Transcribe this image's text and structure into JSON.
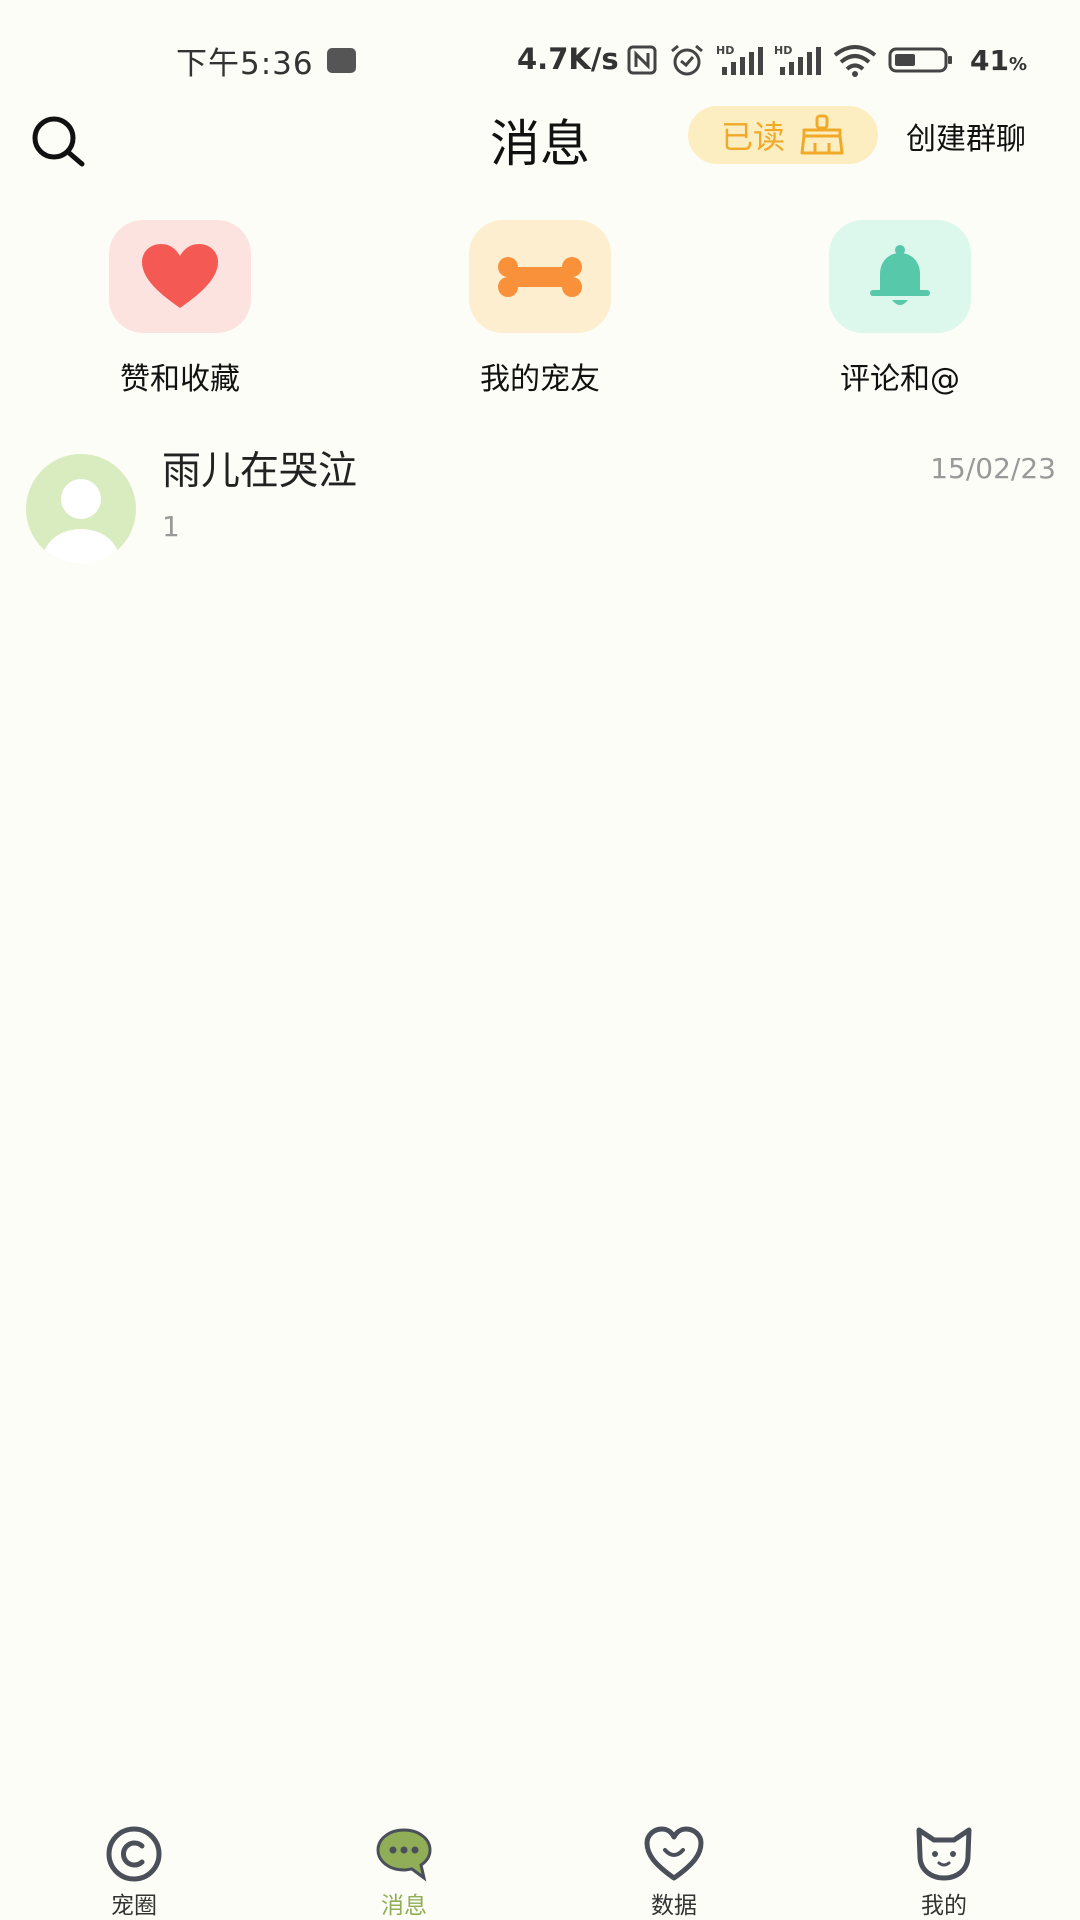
{
  "status_bar": {
    "time": "下午5:36",
    "network_speed": "4.7K/s",
    "battery_percent": "41",
    "battery_unit": "%",
    "icons": [
      "nfc-icon",
      "alarm-icon",
      "hd-signal-icon",
      "hd-signal-icon",
      "wifi-icon",
      "battery-icon"
    ]
  },
  "header": {
    "title": "消息",
    "read_label": "已读",
    "create_group_label": "创建群聊"
  },
  "quick_entries": [
    {
      "label": "赞和收藏",
      "icon": "heart-icon",
      "tile_color": "#fde3df",
      "icon_color": "#f45a53"
    },
    {
      "label": "我的宠友",
      "icon": "bone-icon",
      "tile_color": "#fdeed0",
      "icon_color": "#f8913a"
    },
    {
      "label": "评论和@",
      "icon": "bell-icon",
      "tile_color": "#dcf7ec",
      "icon_color": "#58c8aa"
    }
  ],
  "conversations": [
    {
      "name": "雨儿在哭泣",
      "preview": "1",
      "time": "15/02/23"
    }
  ],
  "bottom_nav": [
    {
      "label": "宠圈",
      "icon": "circle-icon",
      "active": false
    },
    {
      "label": "消息",
      "icon": "chat-bubble-icon",
      "active": true
    },
    {
      "label": "数据",
      "icon": "heart-outline-icon",
      "active": false
    },
    {
      "label": "我的",
      "icon": "cat-face-icon",
      "active": false
    }
  ],
  "colors": {
    "background": "#fdfdf8",
    "accent": "#8fae57",
    "read_badge_bg": "#fdeec2",
    "read_badge_text": "#f0a928"
  }
}
